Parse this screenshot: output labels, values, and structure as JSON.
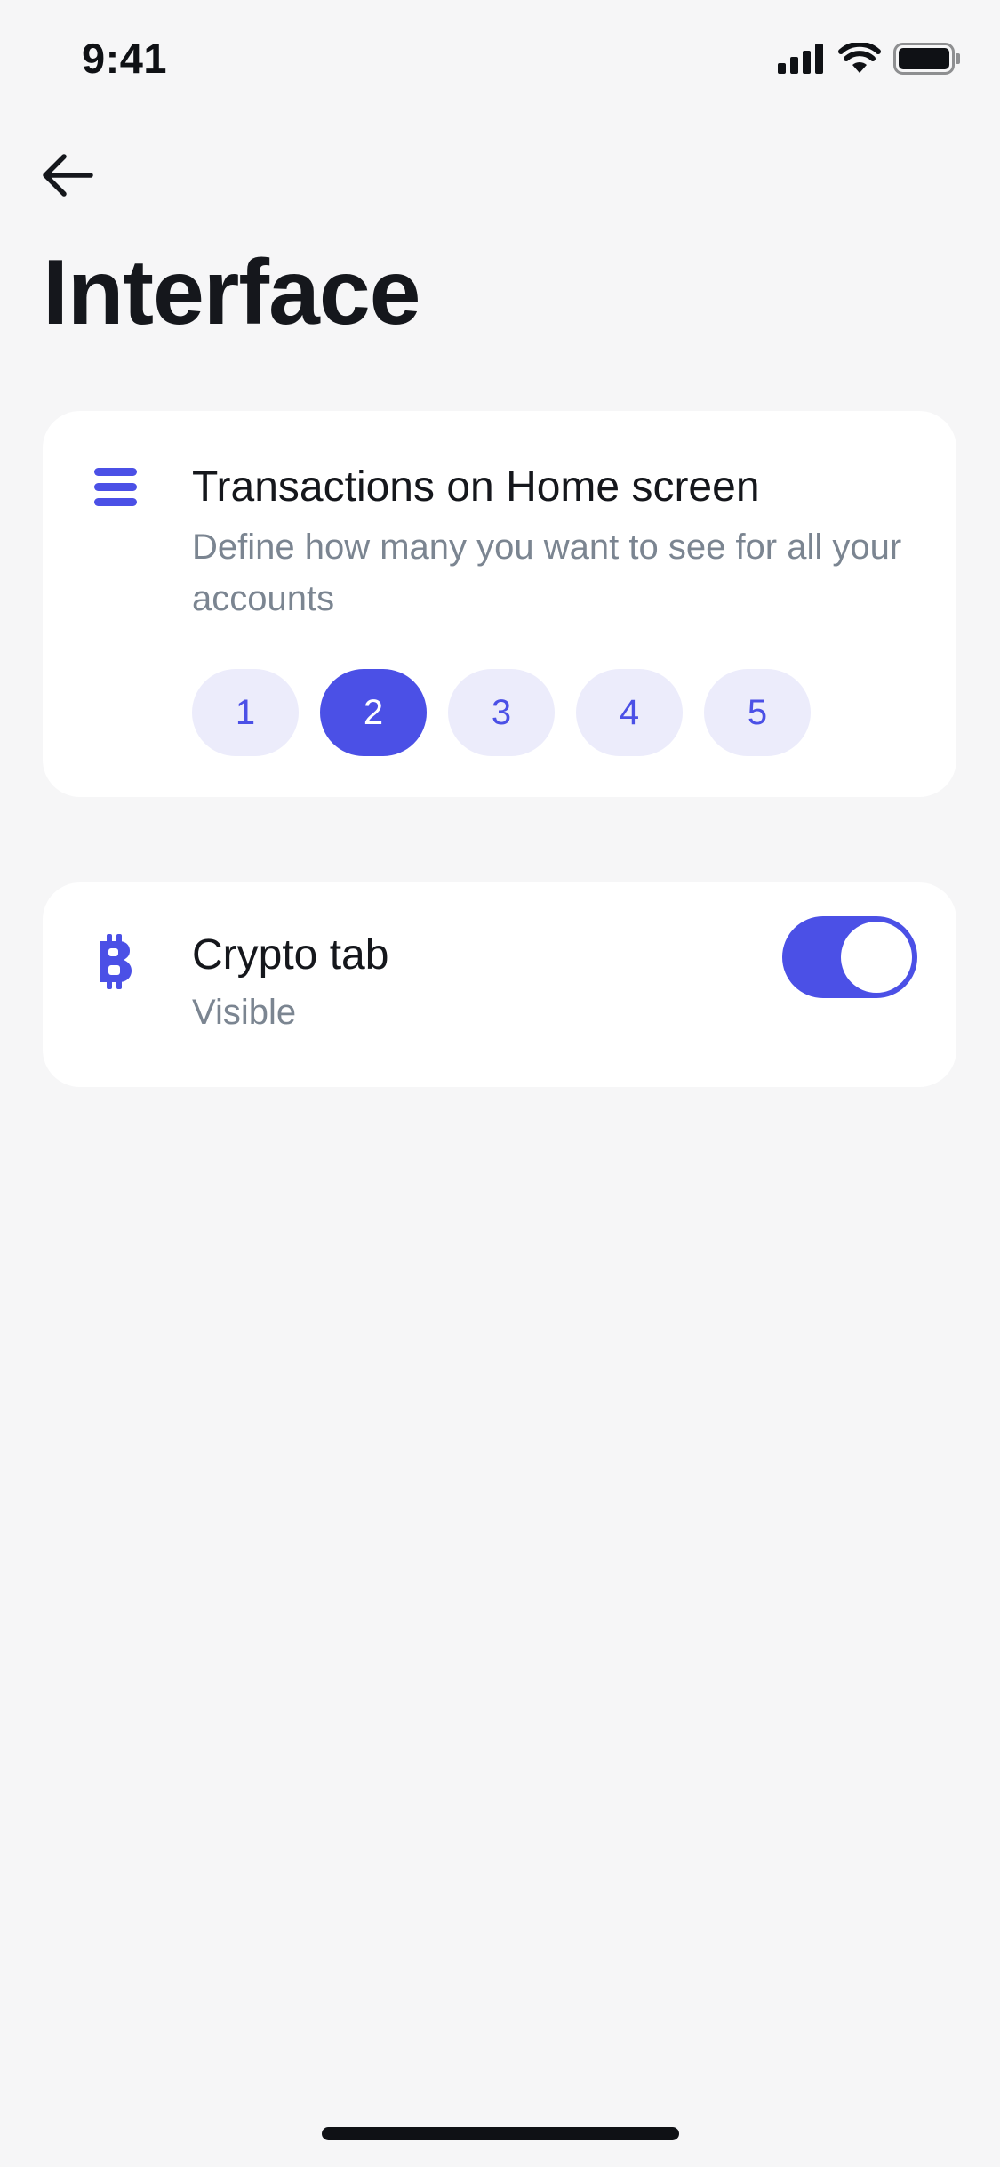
{
  "status_bar": {
    "time": "9:41",
    "icons": [
      "cellular-signal-icon",
      "wifi-icon",
      "battery-icon"
    ]
  },
  "nav": {
    "back_icon": "arrow-left-icon"
  },
  "page": {
    "title": "Interface"
  },
  "transactions_card": {
    "icon": "list-icon",
    "title": "Transactions on Home screen",
    "description": "Define how many you want to see for all your accounts",
    "options": [
      "1",
      "2",
      "3",
      "4",
      "5"
    ],
    "selected": "2"
  },
  "crypto_card": {
    "icon": "bitcoin-icon",
    "title": "Crypto tab",
    "status": "Visible",
    "toggle_on": true
  },
  "colors": {
    "accent": "#4b50e6",
    "chip_background": "#ececfb",
    "page_background": "#f6f6f7",
    "secondary_text": "#7b8591"
  }
}
